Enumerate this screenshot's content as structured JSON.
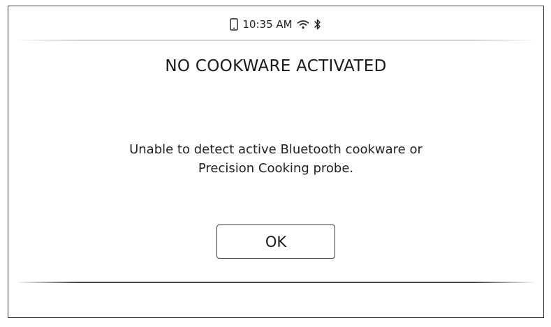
{
  "status_bar": {
    "phone_icon": "phone-icon",
    "time": "10:35 AM",
    "wifi_icon": "wifi-icon",
    "bluetooth_icon": "bluetooth-icon"
  },
  "dialog": {
    "title": "NO COOKWARE ACTIVATED",
    "message_line1": "Unable to detect active Bluetooth cookware or",
    "message_line2": "Precision Cooking probe.",
    "ok_label": "OK"
  }
}
